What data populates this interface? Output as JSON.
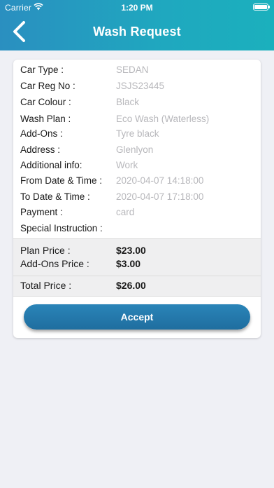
{
  "status_bar": {
    "carrier": "Carrier",
    "time": "1:20 PM"
  },
  "header": {
    "title": "Wash Request",
    "back_icon": "chevron-left-icon"
  },
  "details": [
    {
      "label": "Car Type :",
      "value": "SEDAN"
    },
    {
      "label": "Car Reg No :",
      "value": "JSJS23445"
    },
    {
      "label": "Car Colour :",
      "value": "Black"
    },
    {
      "label": "Wash Plan :",
      "value": "Eco Wash (Waterless)"
    },
    {
      "label": "Add-Ons :",
      "value": "Tyre black"
    },
    {
      "label": "Address :",
      "value": "Glenlyon"
    },
    {
      "label": "Additional info:",
      "value": "Work"
    },
    {
      "label": "From Date & Time :",
      "value": "2020-04-07 14:18:00"
    },
    {
      "label": "To Date & Time :",
      "value": "2020-04-07 17:18:00"
    },
    {
      "label": "Payment :",
      "value": "card"
    },
    {
      "label": "Special Instruction :",
      "value": ""
    }
  ],
  "pricing": {
    "plan_label": "Plan Price :",
    "plan_value": "$23.00",
    "addons_label": "Add-Ons Price :",
    "addons_value": "$3.00",
    "total_label": "Total Price :",
    "total_value": "$26.00"
  },
  "actions": {
    "accept_label": "Accept"
  },
  "colors": {
    "header_start": "#2a8fc0",
    "header_end": "#1bb0bd",
    "button": "#2479ab",
    "background": "#eff0f5"
  }
}
